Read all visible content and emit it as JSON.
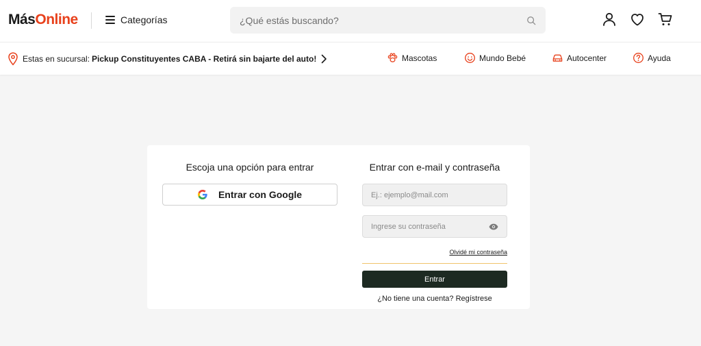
{
  "header": {
    "logo_part1": "Más",
    "logo_part2": "Online",
    "categories_label": "Categorías",
    "search_placeholder": "¿Qué estás buscando?"
  },
  "subbar": {
    "branch_prefix": "Estas en sucursal:",
    "branch_name": "Pickup Constituyentes CABA - Retirá sin bajarte del auto!",
    "links": [
      "Mascotas",
      "Mundo Bebé",
      "Autocenter",
      "Ayuda"
    ]
  },
  "login": {
    "left_title": "Escoja una opción para entrar",
    "google_label": "Entrar con Google",
    "right_title": "Entrar con e-mail y contraseña",
    "email_placeholder": "Ej.: ejemplo@mail.com",
    "password_placeholder": "Ingrese su contraseña",
    "forgot_label": "Olvidé mi contraseña",
    "submit_label": "Entrar",
    "register_label": "¿No tiene una cuenta? Regístrese"
  },
  "colors": {
    "brand_orange": "#e8411c",
    "dark_button": "#1d2a22",
    "accent_line": "#f0c36a"
  }
}
